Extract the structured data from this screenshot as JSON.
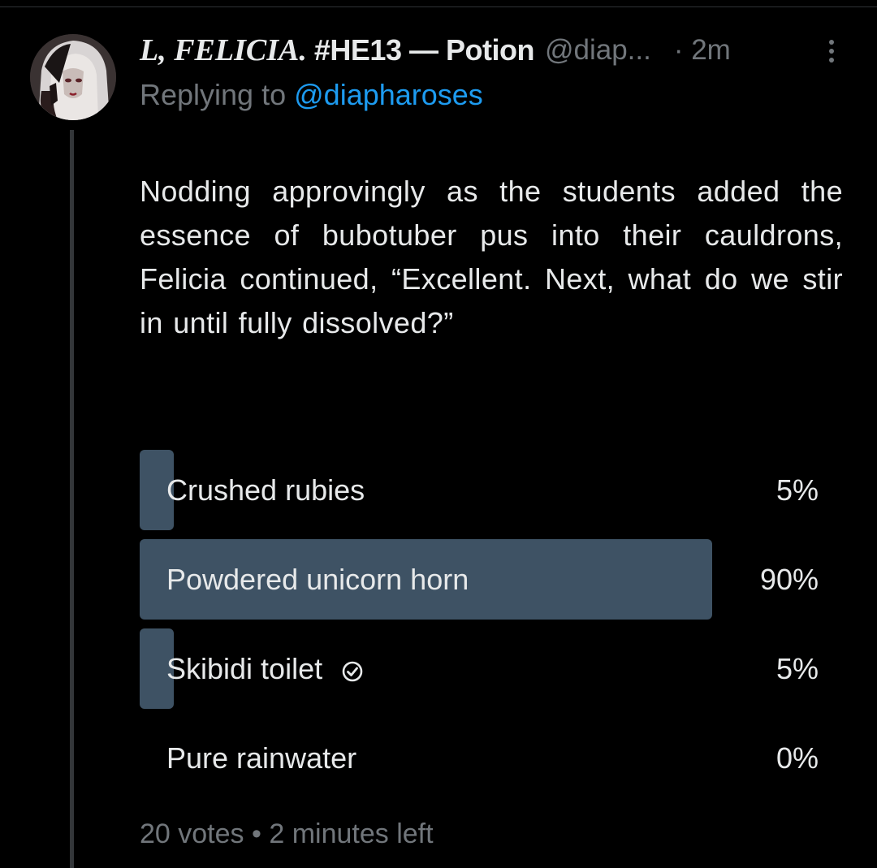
{
  "tweet": {
    "display_name_italic": "L, FELICIA.",
    "display_name_rest": "#HE13 — Potion",
    "handle": "@diap...",
    "time": "· 2m",
    "replying_prefix": "Replying to",
    "replying_handle": "@diapharoses",
    "text": "Nodding approvingly as the students added the essence of bubotuber pus into their cauldrons, Felicia continued, “Excellent. Next, what do we stir in until fully dissolved?”"
  },
  "poll": {
    "options": [
      {
        "label": "Crushed rubies",
        "percent_text": "5%",
        "percent": 5,
        "selected": false
      },
      {
        "label": "Powdered unicorn horn",
        "percent_text": "90%",
        "percent": 90,
        "selected": false
      },
      {
        "label": "Skibidi toilet",
        "percent_text": "5%",
        "percent": 5,
        "selected": true
      },
      {
        "label": "Pure rainwater",
        "percent_text": "0%",
        "percent": 0,
        "selected": false
      }
    ],
    "votes": "20 votes",
    "separator": "•",
    "time_left": "2 minutes left"
  },
  "icons": {
    "more": "more-vertical-icon",
    "selected_check": "check-circle-icon"
  },
  "colors": {
    "background": "#000000",
    "text_primary": "#e7e9ea",
    "text_secondary": "#71767b",
    "link": "#1d9bf0",
    "poll_fill": "#3e5264",
    "thread_line": "#333639"
  }
}
